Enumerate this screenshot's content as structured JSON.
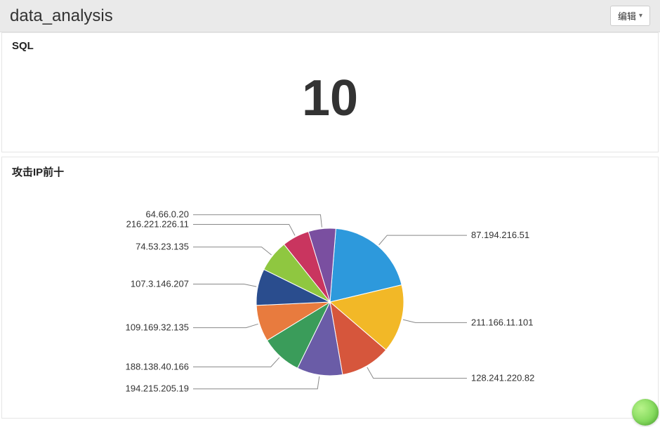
{
  "header": {
    "title": "data_analysis",
    "edit_label": "编辑"
  },
  "sql_panel": {
    "title": "SQL",
    "value": "10"
  },
  "pie_panel": {
    "title": "攻击IP前十"
  },
  "chart_data": {
    "type": "pie",
    "title": "攻击IP前十",
    "series": [
      {
        "name": "87.194.216.51",
        "value": 20,
        "color": "#2d99dc"
      },
      {
        "name": "211.166.11.101",
        "value": 15,
        "color": "#f2b827"
      },
      {
        "name": "128.241.220.82",
        "value": 11,
        "color": "#d6563c"
      },
      {
        "name": "194.215.205.19",
        "value": 10,
        "color": "#6a5ca7"
      },
      {
        "name": "188.138.40.166",
        "value": 9,
        "color": "#3a9c5a"
      },
      {
        "name": "109.169.32.135",
        "value": 8,
        "color": "#e87b3e"
      },
      {
        "name": "107.3.146.207",
        "value": 8,
        "color": "#2a4d8e"
      },
      {
        "name": "74.53.23.135",
        "value": 7,
        "color": "#8fc740"
      },
      {
        "name": "216.221.226.11",
        "value": 6,
        "color": "#c9355f"
      },
      {
        "name": "64.66.0.20",
        "value": 6,
        "color": "#7a4fa0"
      }
    ]
  }
}
